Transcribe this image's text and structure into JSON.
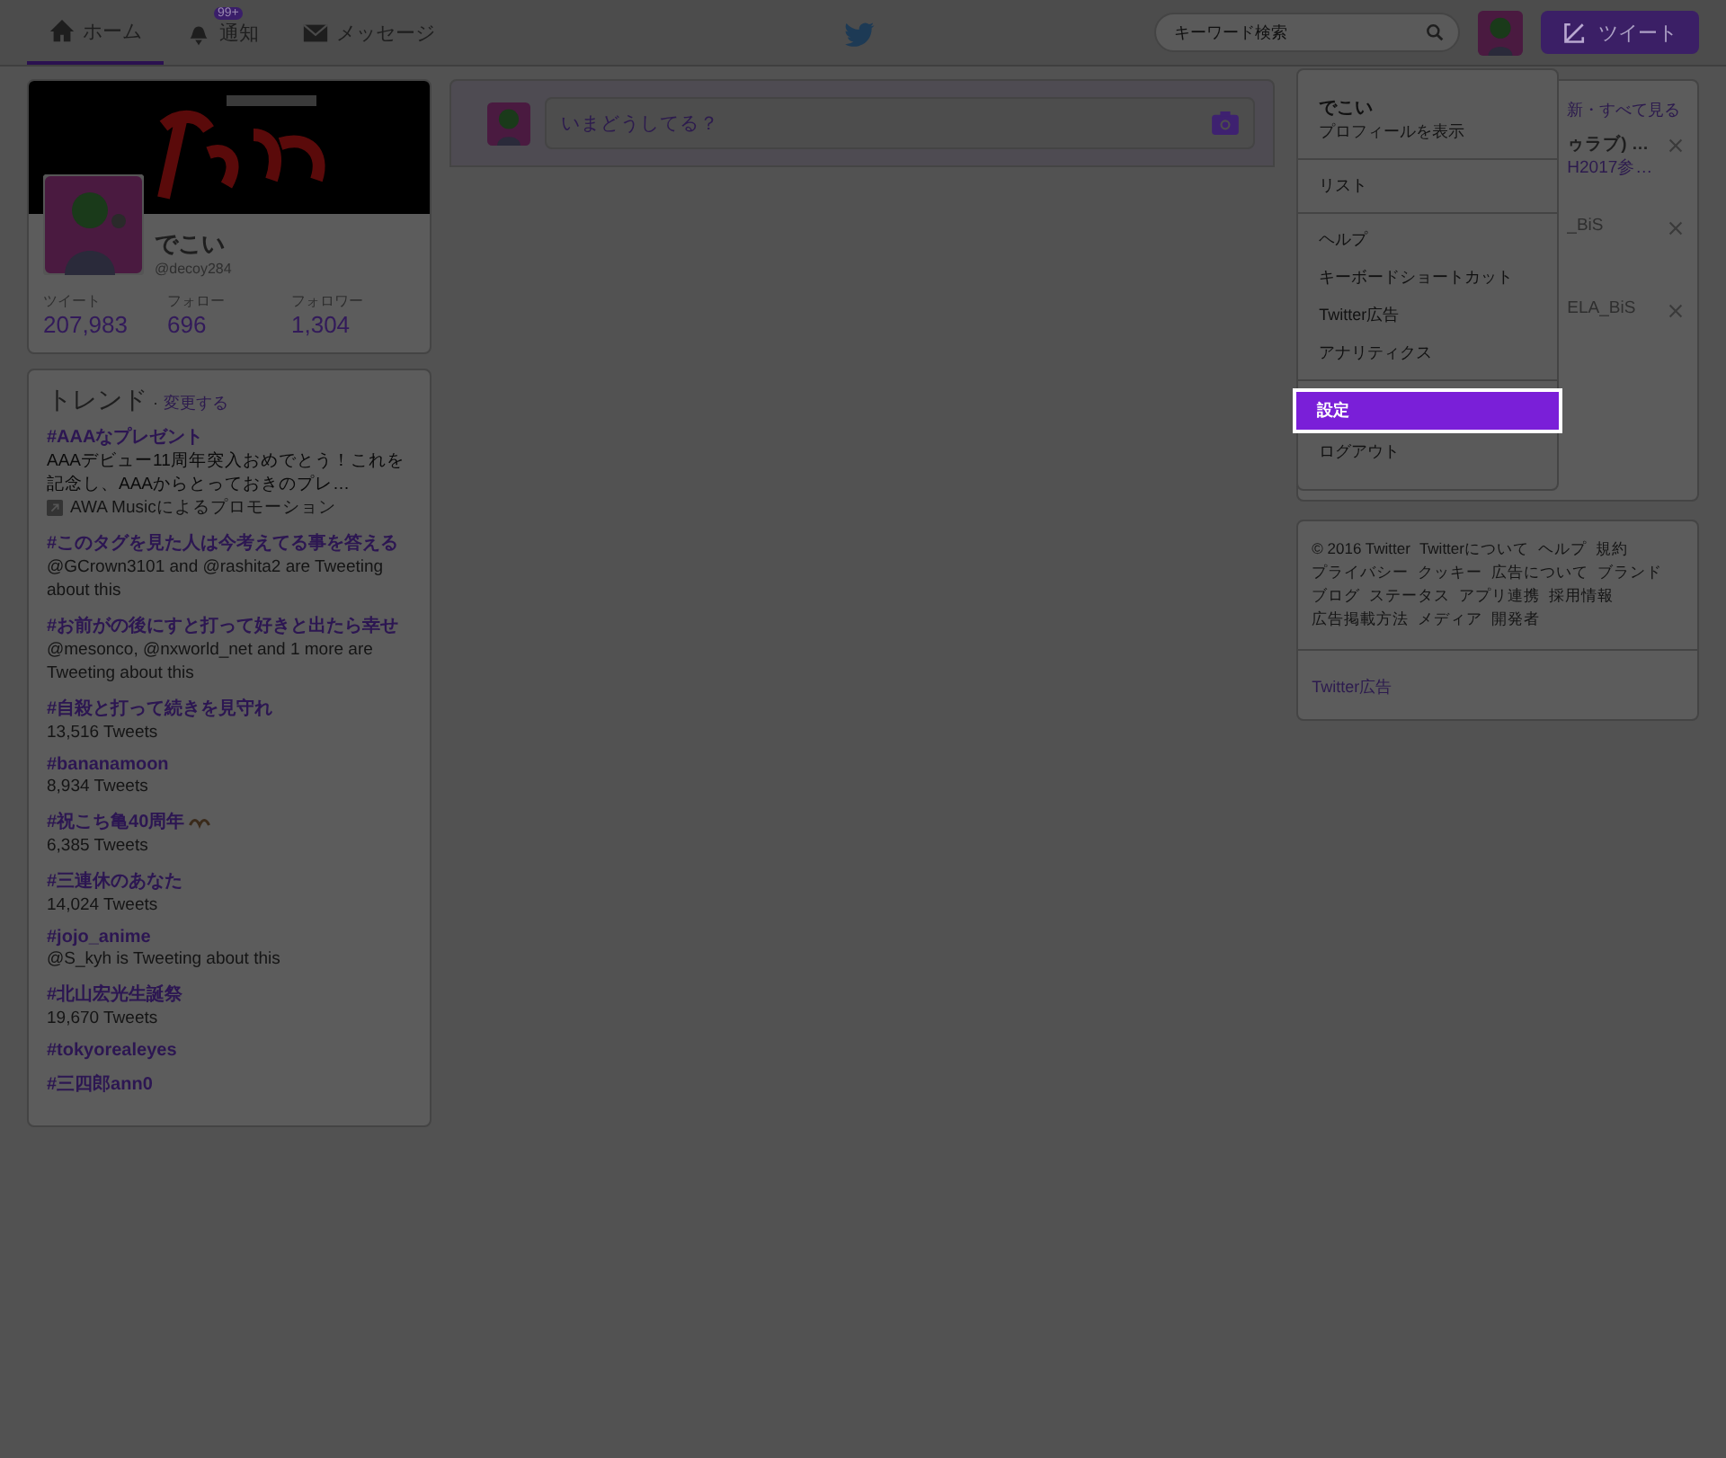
{
  "nav": {
    "tabs": [
      {
        "label": "ホーム",
        "selected": true
      },
      {
        "label": "通知",
        "badge": "99+",
        "selected": false
      },
      {
        "label": "メッセージ",
        "selected": false
      }
    ],
    "search": {
      "placeholder": "キーワード検索"
    },
    "tweet_button": "ツイート"
  },
  "profile": {
    "name": "でこい",
    "handle": "@decoy284",
    "stats": [
      {
        "label": "ツイート",
        "value": "207,983"
      },
      {
        "label": "フォロー",
        "value": "696"
      },
      {
        "label": "フォロワー",
        "value": "1,304"
      }
    ]
  },
  "trends": {
    "title": "トレンド",
    "separator": "·",
    "change_link": "変更する",
    "items": [
      {
        "kind": "promoted",
        "tag": "#AAAなプレゼント",
        "text": "AAAデビュー11周年突入おめでとう！これを記念し、AAAからとっておきのプレ…",
        "promoted_by": "AWA Musicによるプロモーション"
      },
      {
        "kind": "normal",
        "tag": "#このタグを見た人は今考えてる事を答える",
        "text": "@GCrown3101 and @rashita2 are Tweeting about this"
      },
      {
        "kind": "normal",
        "tag": "#お前がの後にすと打って好きと出たら幸せ",
        "text": "@mesonco, @nxworld_net and 1 more are Tweeting about this"
      },
      {
        "kind": "normal",
        "tag": "#自殺と打って続きを見守れ",
        "text": "13,516 Tweets"
      },
      {
        "kind": "normal",
        "tag": "#bananamoon",
        "text": "8,934 Tweets"
      },
      {
        "kind": "emoji",
        "tag": "#祝こち亀40周年",
        "text": "6,385 Tweets"
      },
      {
        "kind": "normal",
        "tag": "#三連休のあなた",
        "text": "14,024 Tweets"
      },
      {
        "kind": "normal",
        "tag": "#jojo_anime",
        "text": "@S_kyh is Tweeting about this"
      },
      {
        "kind": "normal",
        "tag": "#北山宏光生誕祭",
        "text": "19,670 Tweets"
      },
      {
        "kind": "normal",
        "tag": "#tokyorealeyes"
      },
      {
        "kind": "normal",
        "tag": "#三四郎ann0"
      }
    ]
  },
  "composer": {
    "placeholder": "いまどうしてる？"
  },
  "menu": {
    "groups": [
      [
        {
          "label": "でこい",
          "sublabel": "プロフィールを表示",
          "selected": false
        }
      ],
      [
        {
          "label": "リスト",
          "selected": false
        }
      ],
      [
        {
          "label": "ヘルプ",
          "selected": false
        },
        {
          "label": "キーボードショートカット",
          "selected": false
        },
        {
          "label": "Twitter広告",
          "selected": false
        },
        {
          "label": "アナリティクス",
          "selected": false
        }
      ],
      [
        {
          "label": "設定",
          "selected": true
        },
        {
          "label": "ログアウト",
          "selected": false
        }
      ]
    ]
  },
  "who_to_follow": {
    "header_link": "新・すべて見る",
    "items": [
      {
        "name": "ゥラブ) …",
        "sub": "H2017参…"
      },
      {
        "name": "_BiS"
      },
      {
        "name": "ELA_BiS"
      }
    ]
  },
  "footer": {
    "links": [
      "© 2016 Twitter",
      "Twitterについて",
      "ヘルプ",
      "規約",
      "プライバシー",
      "クッキー",
      "広告について",
      "ブランド",
      "ブログ",
      "ステータス",
      "アプリ連携",
      "採用情報",
      "広告掲載方法",
      "メディア",
      "開発者"
    ],
    "ads_link": "Twitter広告"
  }
}
